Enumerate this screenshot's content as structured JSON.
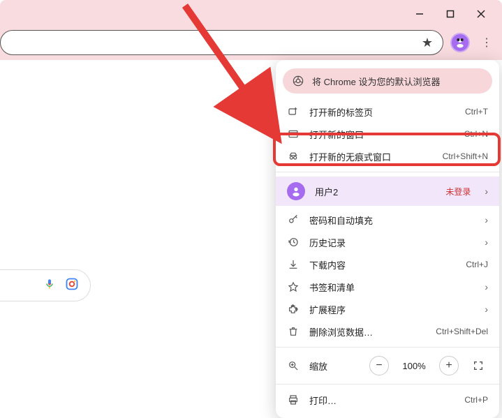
{
  "window": {
    "minimize": "—",
    "maximize": "❐",
    "close": "✕"
  },
  "banner": {
    "text": "将 Chrome 设为您的默认浏览器"
  },
  "menu": {
    "newTab": {
      "label": "打开新的标签页",
      "shortcut": "Ctrl+T"
    },
    "newWindow": {
      "label": "打开新的窗口",
      "shortcut": "Ctrl+N"
    },
    "incognito": {
      "label": "打开新的无痕式窗口",
      "shortcut": "Ctrl+Shift+N"
    },
    "profile": {
      "name": "用户2",
      "status": "未登录"
    },
    "passwords": {
      "label": "密码和自动填充"
    },
    "history": {
      "label": "历史记录"
    },
    "downloads": {
      "label": "下载内容",
      "shortcut": "Ctrl+J"
    },
    "bookmarks": {
      "label": "书签和清单"
    },
    "extensions": {
      "label": "扩展程序"
    },
    "clearData": {
      "label": "删除浏览数据…",
      "shortcut": "Ctrl+Shift+Del"
    },
    "zoom": {
      "label": "缩放",
      "value": "100%"
    },
    "print": {
      "label": "打印…",
      "shortcut": "Ctrl+P"
    }
  }
}
